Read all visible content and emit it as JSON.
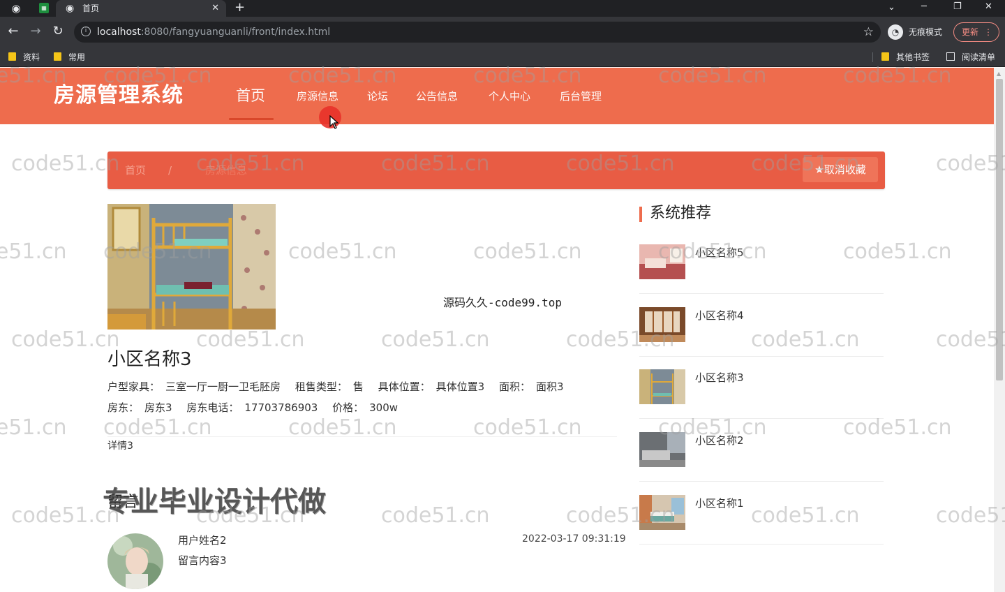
{
  "browser": {
    "tab_title": "首页",
    "url_host": "localhost",
    "url_rest": ":8080/fangyuanguanli/front/index.html",
    "incognito_label": "无痕模式",
    "update_label": "更新",
    "bookmarks": [
      {
        "label": "资料"
      },
      {
        "label": "常用"
      },
      {
        "label": "其他书签"
      },
      {
        "label": "阅读清单"
      }
    ]
  },
  "site": {
    "logo": "房源管理系统",
    "nav": [
      {
        "label": "首页"
      },
      {
        "label": "房源信息"
      },
      {
        "label": "论坛"
      },
      {
        "label": "公告信息"
      },
      {
        "label": "个人中心"
      },
      {
        "label": "后台管理"
      }
    ],
    "accent_color": "#ee6c4d"
  },
  "breadcrumb": {
    "home": "首页",
    "separator": "/",
    "current": "房源信息",
    "unfavorite_label": "取消收藏"
  },
  "detail": {
    "promo_text": "源码久久-code99.top",
    "name": "小区名称3",
    "row1": [
      {
        "key": "户型家具：",
        "value": "三室一厅一厨一卫毛胚房"
      },
      {
        "key": "租售类型：",
        "value": "售"
      },
      {
        "key": "具体位置：",
        "value": "具体位置3"
      },
      {
        "key": "面积：",
        "value": "面积3"
      }
    ],
    "row2": [
      {
        "key": "房东：",
        "value": "房东3"
      },
      {
        "key": "房东电话：",
        "value": "17703786903"
      },
      {
        "key": "价格：",
        "value": "300w"
      }
    ],
    "description": "详情3"
  },
  "overlay_ad": "专业毕业设计代做",
  "comments": {
    "title": "留言",
    "items": [
      {
        "user": "用户姓名2",
        "content": "留言内容3",
        "time": "2022-03-17 09:31:19"
      }
    ]
  },
  "recommend": {
    "title": "系统推荐",
    "items": [
      {
        "name": "小区名称5"
      },
      {
        "name": "小区名称4"
      },
      {
        "name": "小区名称3"
      },
      {
        "name": "小区名称2"
      },
      {
        "name": "小区名称1"
      }
    ]
  },
  "watermark_text": "code51.cn"
}
